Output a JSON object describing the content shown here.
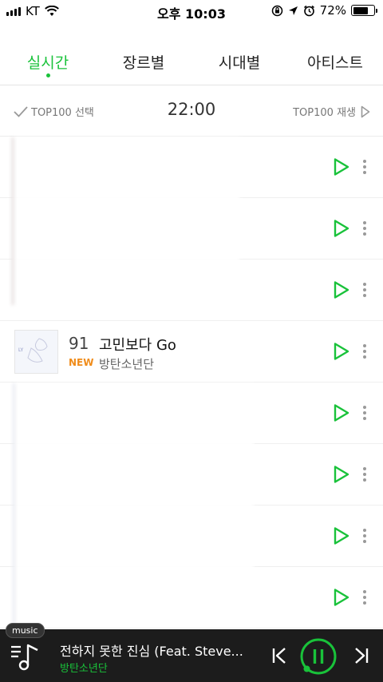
{
  "status": {
    "carrier": "KT",
    "time": "오후 10:03",
    "battery": "72%",
    "battery_level": 0.72
  },
  "tabs": [
    {
      "label": "실시간",
      "active": true
    },
    {
      "label": "장르별",
      "active": false
    },
    {
      "label": "시대별",
      "active": false
    },
    {
      "label": "아티스트",
      "active": false
    }
  ],
  "topbar": {
    "select_label": "TOP100 선택",
    "time": "22:00",
    "play_label": "TOP100 재생"
  },
  "rows": [
    {
      "rank": "",
      "title": "",
      "artist": "",
      "new": ""
    },
    {
      "rank": "",
      "title": "",
      "artist": "",
      "new": ""
    },
    {
      "rank": "",
      "title": "",
      "artist": "",
      "new": ""
    },
    {
      "rank": "91",
      "title": "고민보다 Go",
      "artist": "방탄소년단",
      "new": "NEW"
    },
    {
      "rank": "",
      "title": "",
      "artist": "",
      "new": ""
    },
    {
      "rank": "",
      "title": "",
      "artist": "",
      "new": ""
    },
    {
      "rank": "",
      "title": "",
      "artist": "",
      "new": ""
    },
    {
      "rank": "",
      "title": "",
      "artist": "",
      "new": ""
    }
  ],
  "player": {
    "tag": "music",
    "title": "전하지 못한 진심 (Feat. Steve...",
    "artist": "방탄소년단"
  },
  "colors": {
    "accent": "#19c23a",
    "new_badge": "#f08c1a",
    "player_bg": "#1c1c1c"
  },
  "icons": {
    "check": "check-icon",
    "play": "play-icon",
    "more": "more-vertical-icon",
    "playlist": "playlist-music-icon",
    "prev": "skip-previous-icon",
    "pause": "pause-icon",
    "next": "skip-next-icon"
  }
}
